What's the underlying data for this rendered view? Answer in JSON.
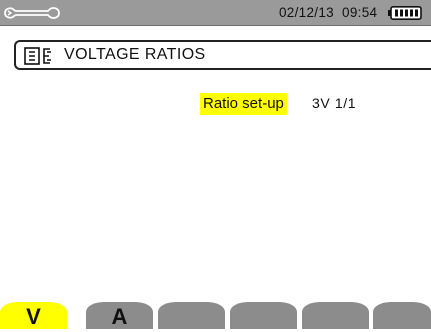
{
  "status_bar": {
    "wrench_icon": "wrench-icon",
    "datetime": "02/12/13  09:54",
    "battery_icon": "battery-full-icon"
  },
  "screen": {
    "title_icon": "voltage-ratio-icon",
    "title": "VOLTAGE RATIOS"
  },
  "ratio_setup": {
    "label": "Ratio set-up",
    "value": "3V 1/1"
  },
  "tabs": [
    {
      "label": "V",
      "active": true
    },
    {
      "label": "A",
      "active": false
    },
    {
      "label": "",
      "active": false
    },
    {
      "label": "",
      "active": false
    },
    {
      "label": "",
      "active": false
    },
    {
      "label": "",
      "active": false
    }
  ],
  "colors": {
    "status_bar": "#9a9a9a",
    "highlight": "#ffff00",
    "tab_inactive": "#8c8c8c"
  }
}
